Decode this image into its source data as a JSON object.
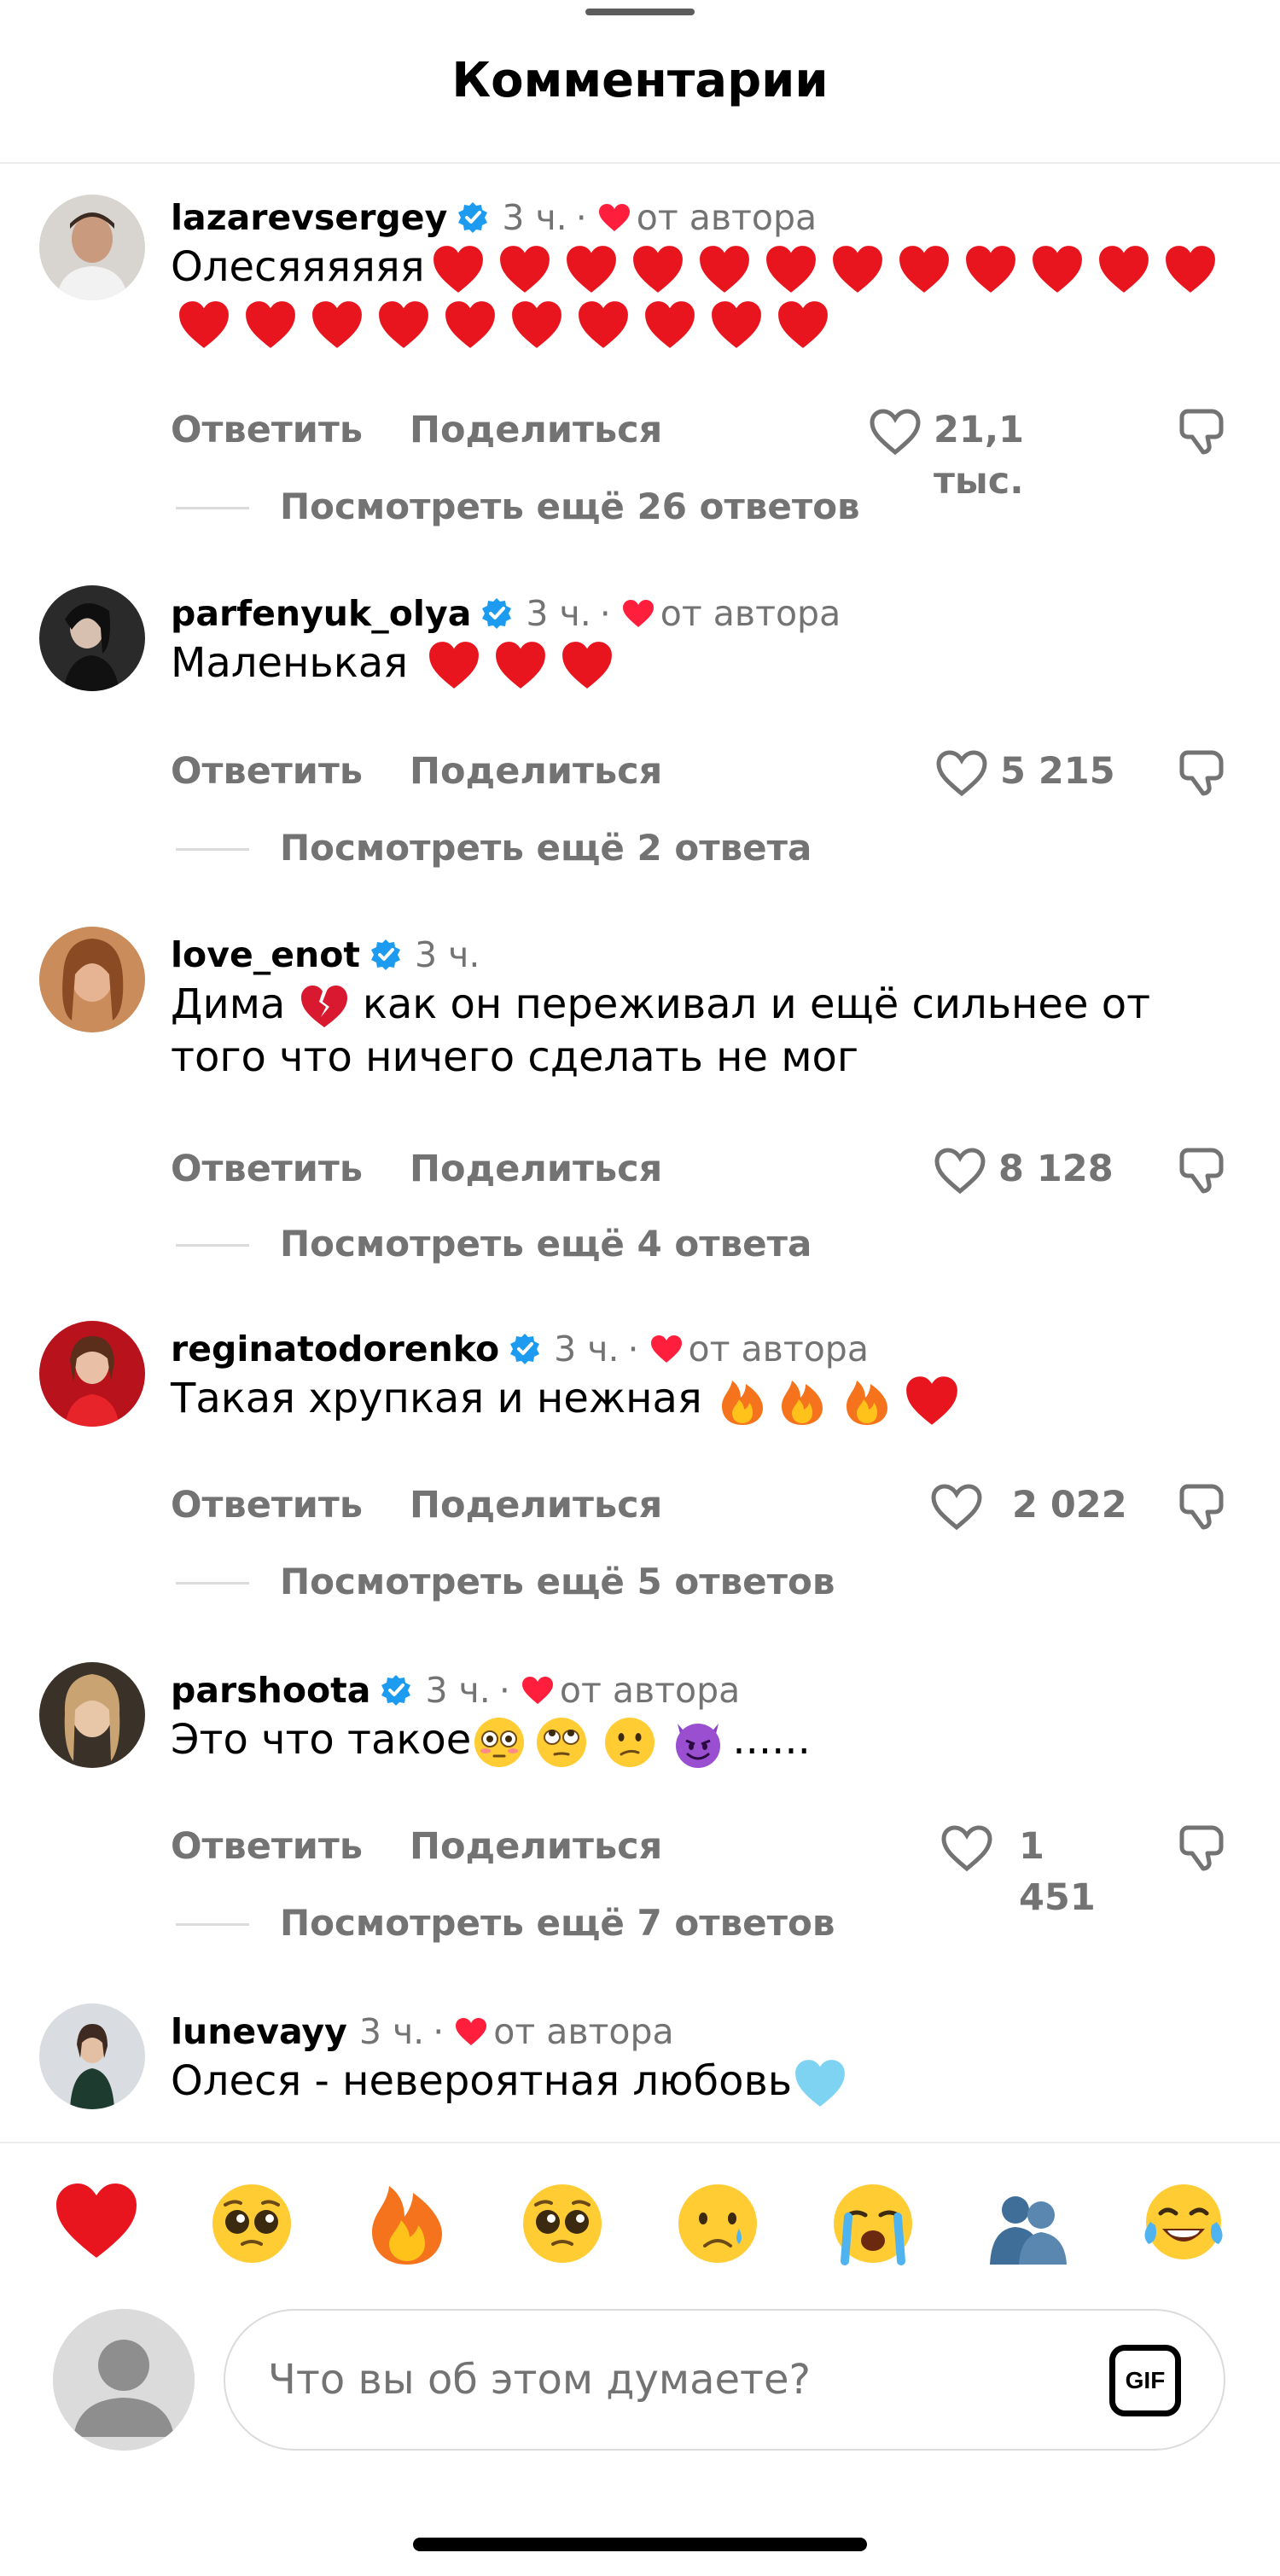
{
  "sheet": {
    "title": "Комментарии"
  },
  "comments": [
    {
      "username": "lazarevsergey",
      "verified": true,
      "time": "3 ч.",
      "separator": "·",
      "by_author": "от автора",
      "text": "Олесяяяяяя",
      "trailing_emoji": "heart",
      "trailing_emoji_count": 22,
      "reply_label": "Ответить",
      "share_label": "Поделиться",
      "likes": "21,1 тыс.",
      "view_replies": "Посмотреть ещё 26 ответов"
    },
    {
      "username": "parfenyuk_olya",
      "verified": true,
      "time": "3 ч.",
      "separator": "·",
      "by_author": "от автора",
      "text": "Маленькая ",
      "trailing_emoji": "heart",
      "trailing_emoji_count": 3,
      "reply_label": "Ответить",
      "share_label": "Поделиться",
      "likes": "5 215",
      "view_replies": "Посмотреть ещё 2 ответа"
    },
    {
      "username": "love_enot",
      "verified": true,
      "time": "3 ч.",
      "text_before_emoji": "Дима ",
      "inline_emoji": "broken-heart",
      "text_after_emoji": " как он переживал и ещё сильнее от того что ничего сделать не мог",
      "reply_label": "Ответить",
      "share_label": "Поделиться",
      "likes": "8 128",
      "view_replies": "Посмотреть ещё 4 ответа"
    },
    {
      "username": "reginatodorenko",
      "verified": true,
      "time": "3 ч.",
      "separator": "·",
      "by_author": "от автора",
      "text": "Такая хрупкая и нежная ",
      "trailing_emojis": [
        "fire",
        "fire",
        "fire",
        "heart"
      ],
      "reply_label": "Ответить",
      "share_label": "Поделиться",
      "likes": "2 022",
      "view_replies": "Посмотреть ещё 5 ответов"
    },
    {
      "username": "parshoota",
      "verified": true,
      "time": "3 ч.",
      "separator": "·",
      "by_author": "от автора",
      "text": "Это что такое",
      "trailing_emojis": [
        "flushed-face",
        "eye-roll-face",
        "confused-face",
        "smiling-devil"
      ],
      "text_end": "......",
      "reply_label": "Ответить",
      "share_label": "Поделиться",
      "likes": "1 451",
      "view_replies": "Посмотреть ещё 7 ответов"
    },
    {
      "username": "lunevayy",
      "verified": false,
      "time": "3 ч.",
      "separator": "·",
      "by_author": "от автора",
      "text": "Олеся - невероятная любовь",
      "trailing_emojis": [
        "light-blue-heart"
      ]
    }
  ],
  "quick_reactions": [
    "heart",
    "pleading-face",
    "fire",
    "pleading-face",
    "crying-face",
    "loudly-crying-face",
    "hugging-people",
    "tears-of-joy-face"
  ],
  "composer": {
    "placeholder": "Что вы об этом думаете?",
    "gif_label": "GIF"
  },
  "colors": {
    "text": "#000000",
    "secondary": "#737373",
    "heart_red": "#ff1e3c",
    "verified_blue": "#1d9bf0",
    "divider": "#dbdbdb"
  }
}
